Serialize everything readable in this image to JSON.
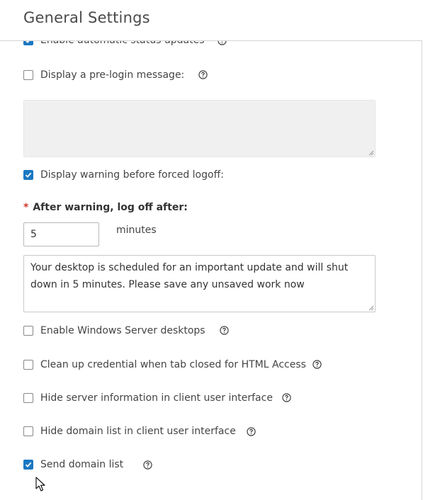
{
  "header": {
    "title": "General Settings"
  },
  "settings": {
    "auto_status": {
      "label": "Enable automatic status updates",
      "checked": true
    },
    "prelogin": {
      "label": "Display a pre-login message:",
      "checked": false,
      "message": ""
    },
    "warning": {
      "label": "Display warning before forced logoff:",
      "checked": true
    },
    "logoff_after": {
      "label": "After warning, log off after:",
      "value": "5",
      "units": "minutes"
    },
    "warning_message": "Your desktop is scheduled for an important update and will shut down in 5 minutes. Please save any unsaved work now",
    "windows_server": {
      "label": "Enable Windows Server desktops",
      "checked": false
    },
    "cleanup_credential": {
      "label": "Clean up credential when tab closed for HTML Access",
      "checked": false
    },
    "hide_server_info": {
      "label": "Hide server information in client user interface",
      "checked": false
    },
    "hide_domain_list": {
      "label": "Hide domain list in client user interface",
      "checked": false
    },
    "send_domain_list": {
      "label": "Send domain list",
      "checked": true
    }
  },
  "colors": {
    "accent": "#1a78c2",
    "required": "#d0372a"
  }
}
